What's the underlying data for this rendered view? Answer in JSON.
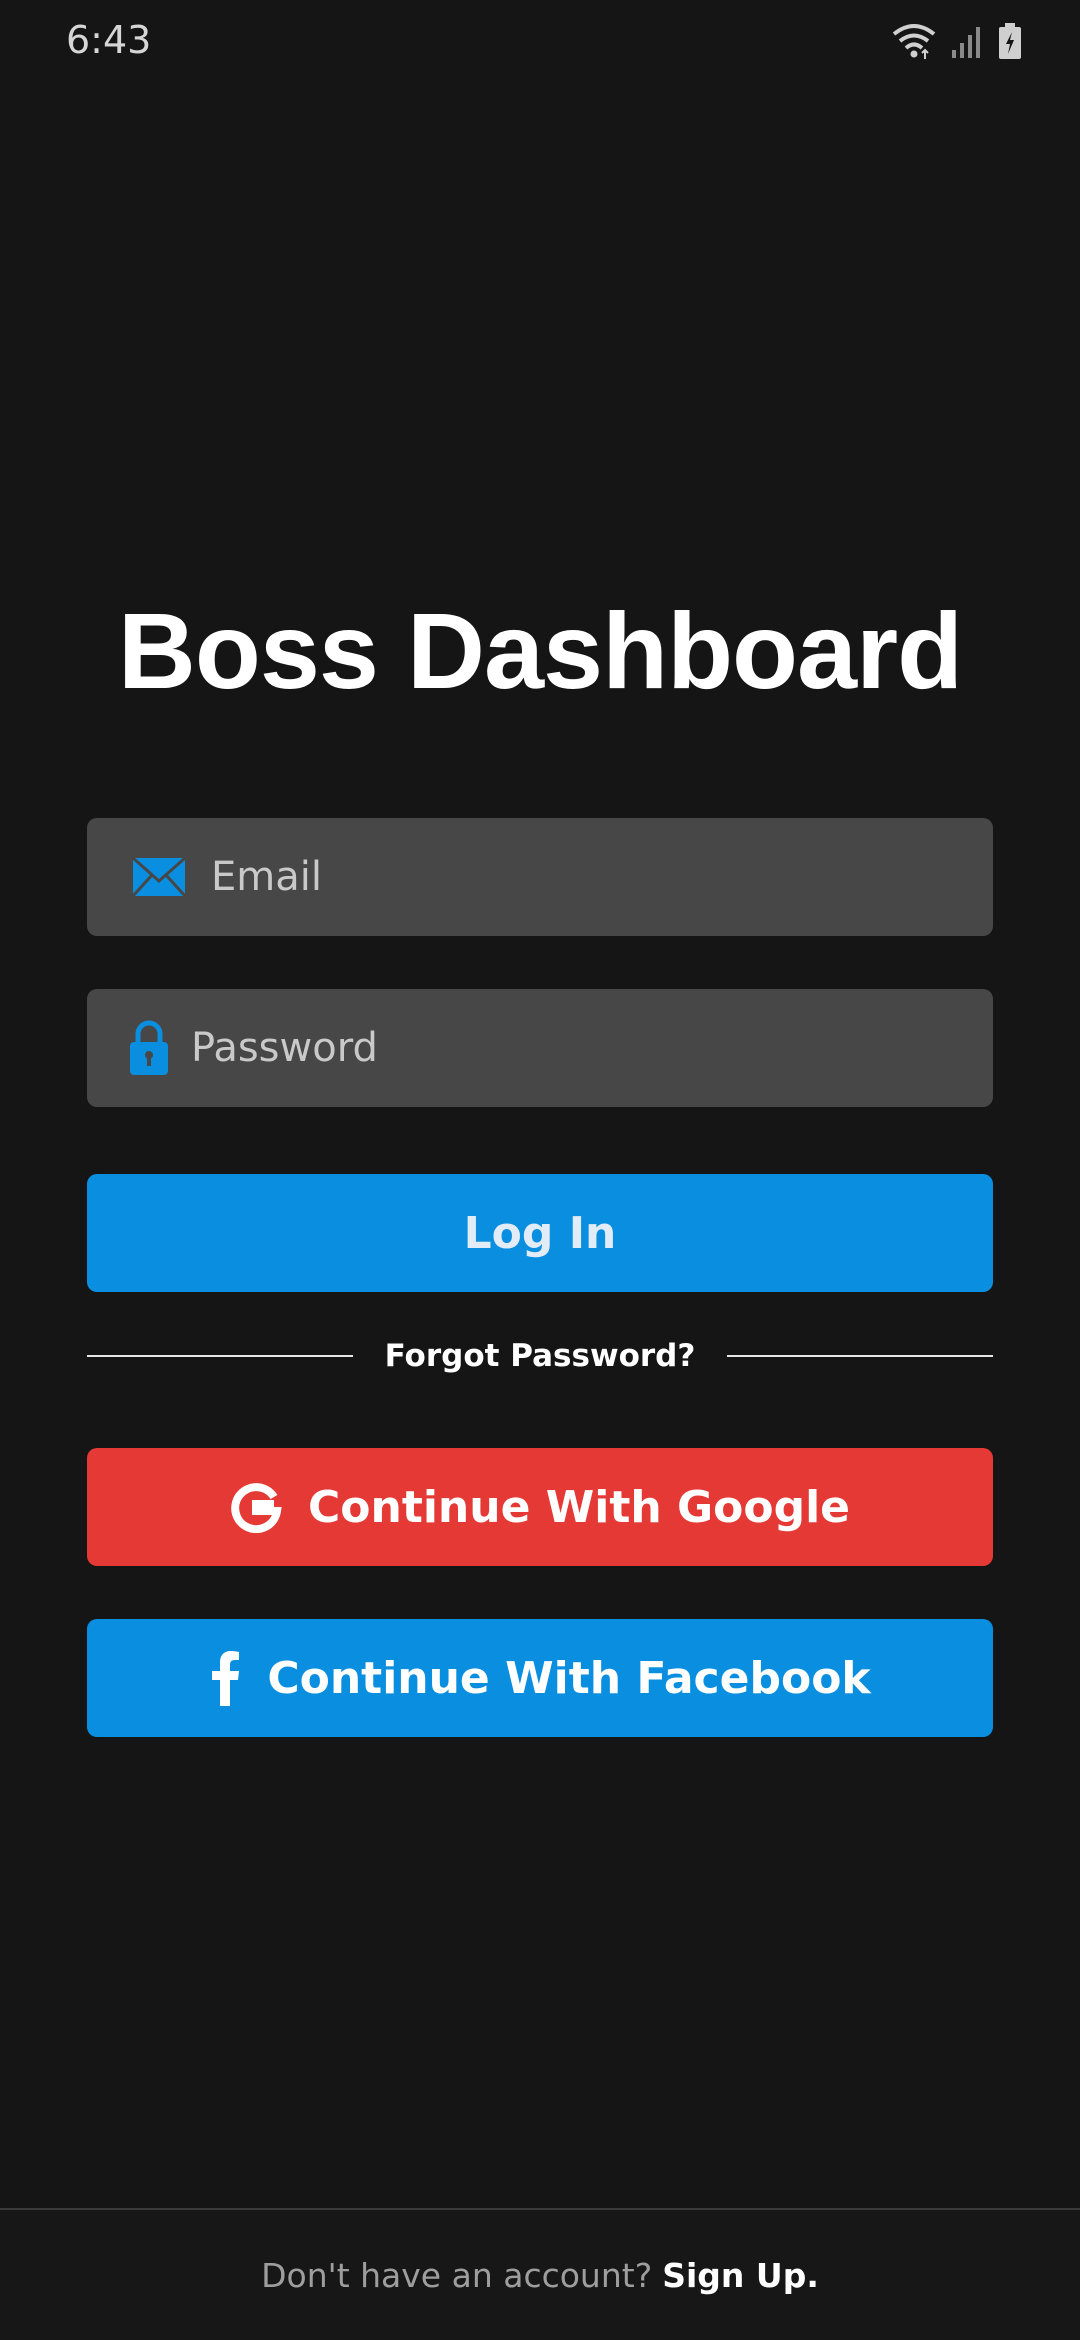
{
  "status_bar": {
    "time": "6:43",
    "icons": [
      "wifi-icon",
      "signal-icon",
      "battery-charging-icon"
    ]
  },
  "app": {
    "title": "Boss Dashboard"
  },
  "form": {
    "email": {
      "placeholder": "Email",
      "value": "",
      "icon": "envelope-icon"
    },
    "password": {
      "placeholder": "Password",
      "value": "",
      "icon": "lock-icon"
    },
    "login_label": "Log In",
    "forgot_label": "Forgot Password?"
  },
  "social": {
    "google_label": "Continue With Google",
    "google_icon": "google-icon",
    "facebook_label": "Continue With Facebook",
    "facebook_icon": "facebook-icon"
  },
  "footer": {
    "prompt": "Don't have an account?",
    "signup_label": "Sign Up."
  },
  "colors": {
    "background": "#151515",
    "input_bg": "#474747",
    "accent_blue": "#0a8ee0",
    "google_red": "#e53935"
  }
}
